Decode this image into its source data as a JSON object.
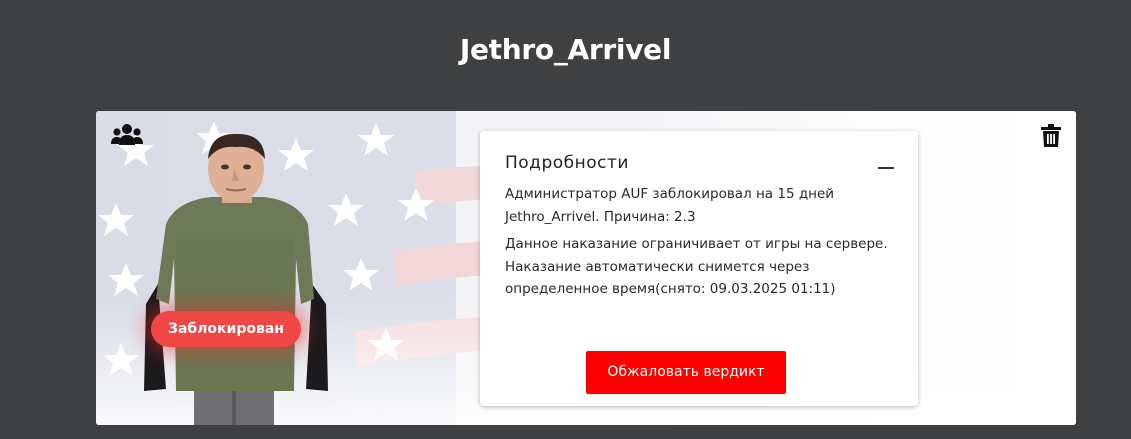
{
  "page": {
    "title": "Jethro_Arrivel"
  },
  "card": {
    "status_badge": "Заблокирован",
    "icons": {
      "left": "group-users-icon",
      "right": "trash-icon"
    },
    "details": {
      "title": "Подробности",
      "collapse_icon": "minus-icon",
      "line_1": "Администратор AUF заблокировал на 15 дней Jethro_Arrivel. Причина: 2.3",
      "line_2": "Данное наказание ограничивает от игры на сервере. Наказание автоматически снимется через определенное время(снято: 09.03.2025 01:11)",
      "appeal_button": "Обжаловать вердикт"
    }
  },
  "colors": {
    "page_background": "#3f4042",
    "accent_red": "#ff0000",
    "badge_red": "#f04646"
  }
}
